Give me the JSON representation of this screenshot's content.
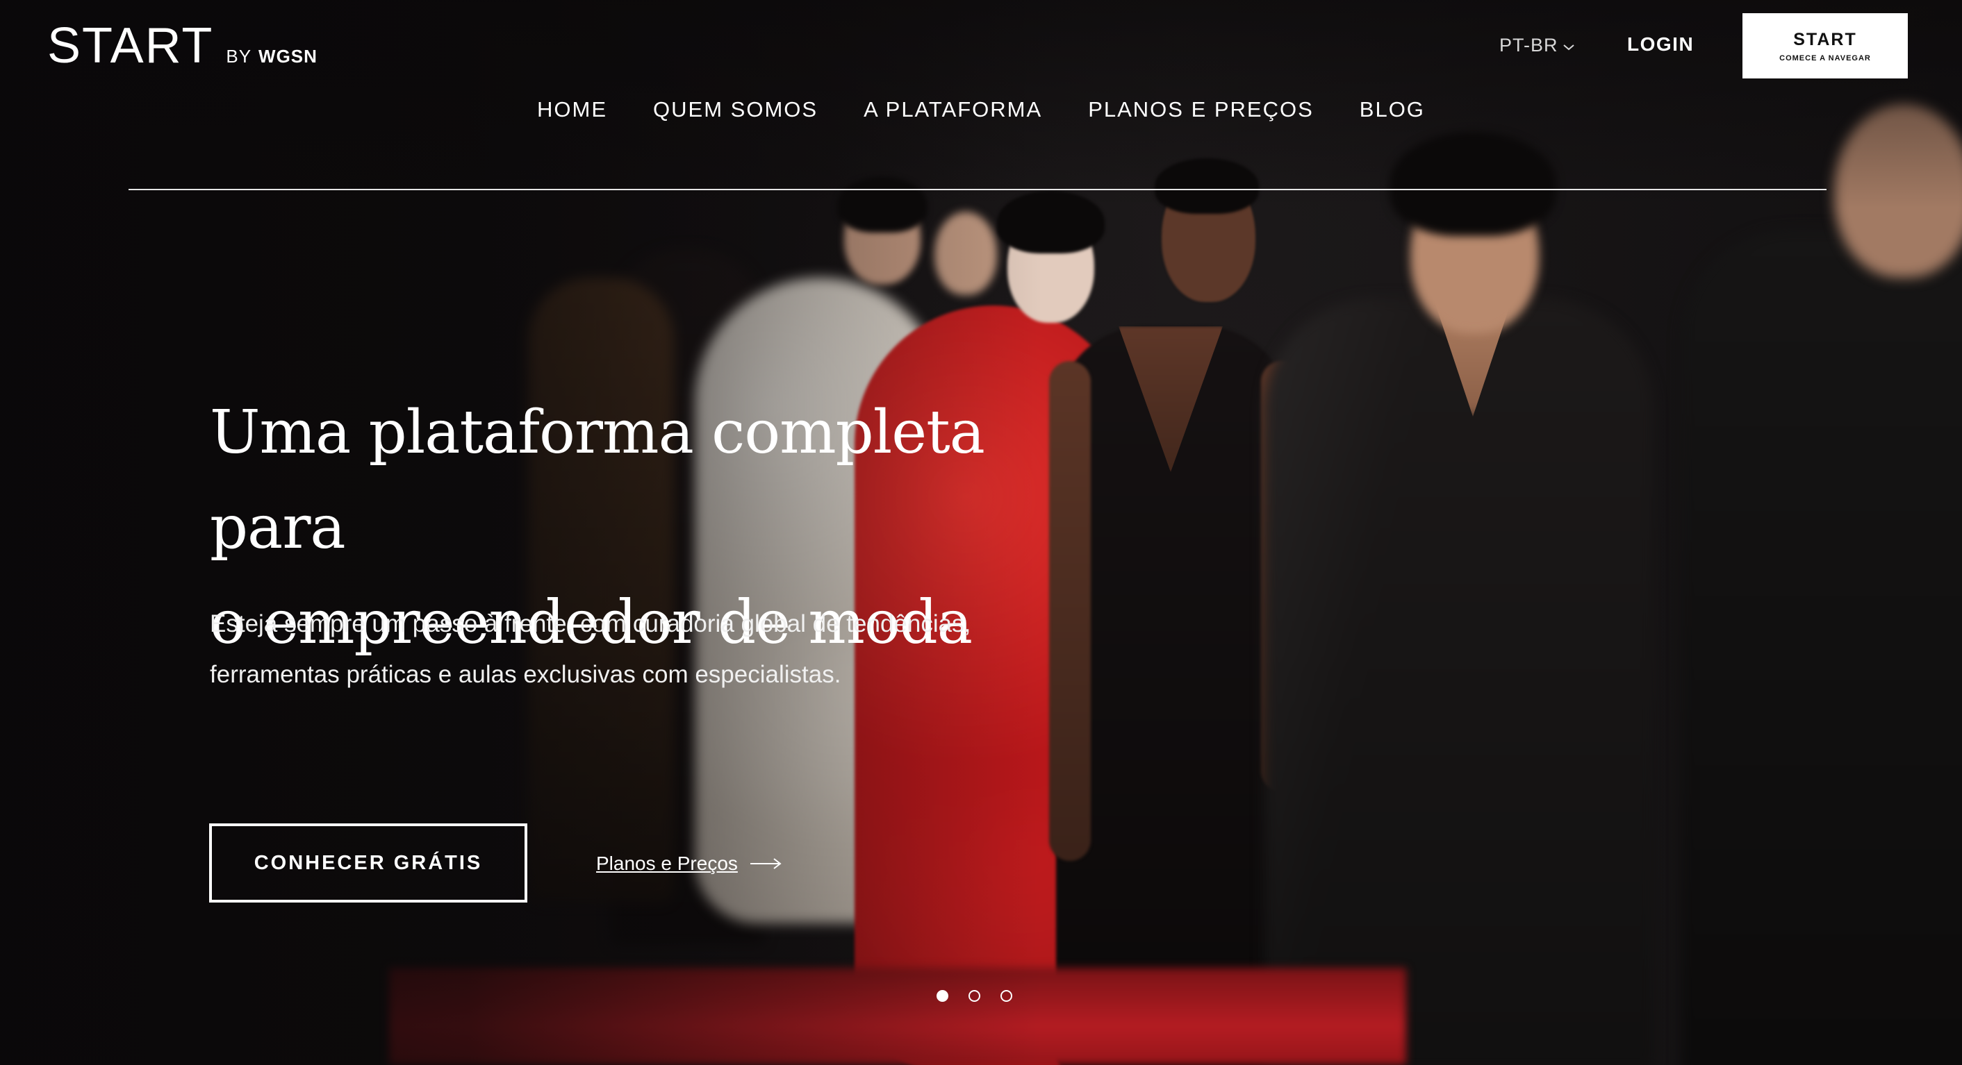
{
  "logo": {
    "main": "START",
    "by": "BY",
    "brand": "WGSN"
  },
  "header": {
    "language": "PT-BR",
    "login": "LOGIN",
    "start_button": {
      "title": "START",
      "subtitle": "COMECE A NAVEGAR"
    }
  },
  "nav": {
    "items": [
      "HOME",
      "QUEM SOMOS",
      "A PLATAFORMA",
      "PLANOS E PREÇOS",
      "BLOG"
    ]
  },
  "hero": {
    "headline_line1": "Uma plataforma completa para",
    "headline_line2": "o empreendedor de moda",
    "subtext_line1": "Esteja sempre um passo à frente, com curadoria global de tendências,",
    "subtext_line2": "ferramentas práticas e aulas exclusivas com especialistas.",
    "cta_label": "CONHECER GRÁTIS",
    "plans_link": "Planos e Preços"
  },
  "carousel": {
    "slide_count": 3,
    "active_index": 0
  },
  "colors": {
    "text": "#ffffff",
    "button_bg": "#ffffff",
    "button_text": "#111111",
    "runway_red": "#b41c22"
  },
  "icons": {
    "language": "chevron-down-icon",
    "plans_link": "arrow-right-icon"
  }
}
